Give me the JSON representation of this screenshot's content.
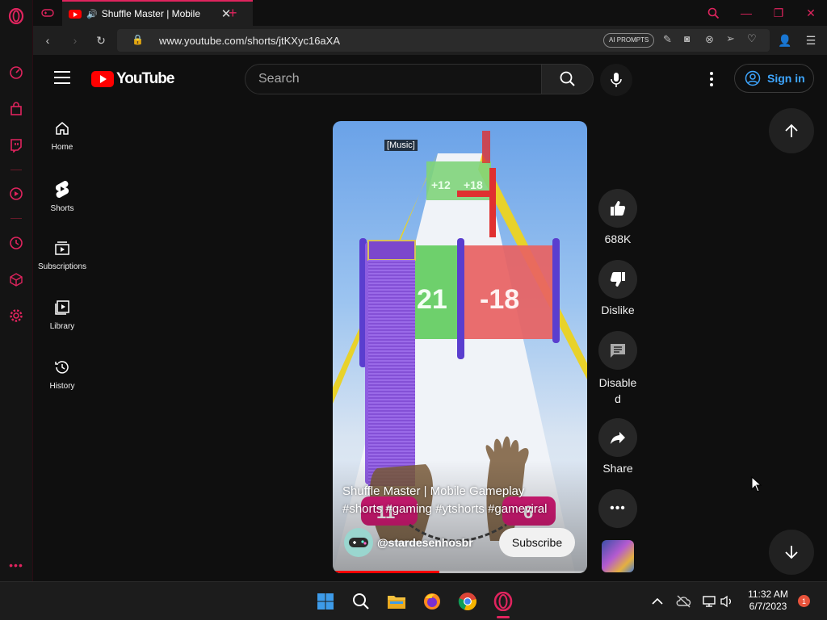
{
  "browser": {
    "tab_title": "Shuffle Master | Mobile",
    "url": "www.youtube.com/shorts/jtKXyc16aXA",
    "ai_prompts_label": "AI PROMPTS"
  },
  "header": {
    "logo_text": "YouTube",
    "search_placeholder": "Search",
    "signin_label": "Sign in"
  },
  "guide": {
    "items": [
      {
        "label": "Home",
        "icon": "home-icon"
      },
      {
        "label": "Shorts",
        "icon": "shorts-icon"
      },
      {
        "label": "Subscriptions",
        "icon": "subscriptions-icon"
      },
      {
        "label": "Library",
        "icon": "library-icon"
      },
      {
        "label": "History",
        "icon": "history-icon"
      }
    ]
  },
  "short": {
    "caption": "[Music]",
    "title_line1": "Shuffle Master | Mobile Gameplay",
    "title_line2": "#shorts #gaming #ytshorts #gameviral",
    "channel": "@stardesenhosbr",
    "subscribe_label": "Subscribe",
    "game_gate_left": "21",
    "game_gate_right": "-18",
    "game_far_left": "+12",
    "game_far_right": "+18",
    "pill_left": "11",
    "pill_right": "6",
    "progress": 0.42
  },
  "actions": {
    "like_count": "688K",
    "dislike_label": "Dislike",
    "comments_label_1": "Disable",
    "comments_label_2": "d",
    "share_label": "Share"
  },
  "taskbar": {
    "time": "11:32 AM",
    "date": "6/7/2023",
    "notification_count": "1"
  },
  "colors": {
    "opera_accent": "#e0245e",
    "yt_red": "#ff0000",
    "link_blue": "#3ea6ff"
  }
}
